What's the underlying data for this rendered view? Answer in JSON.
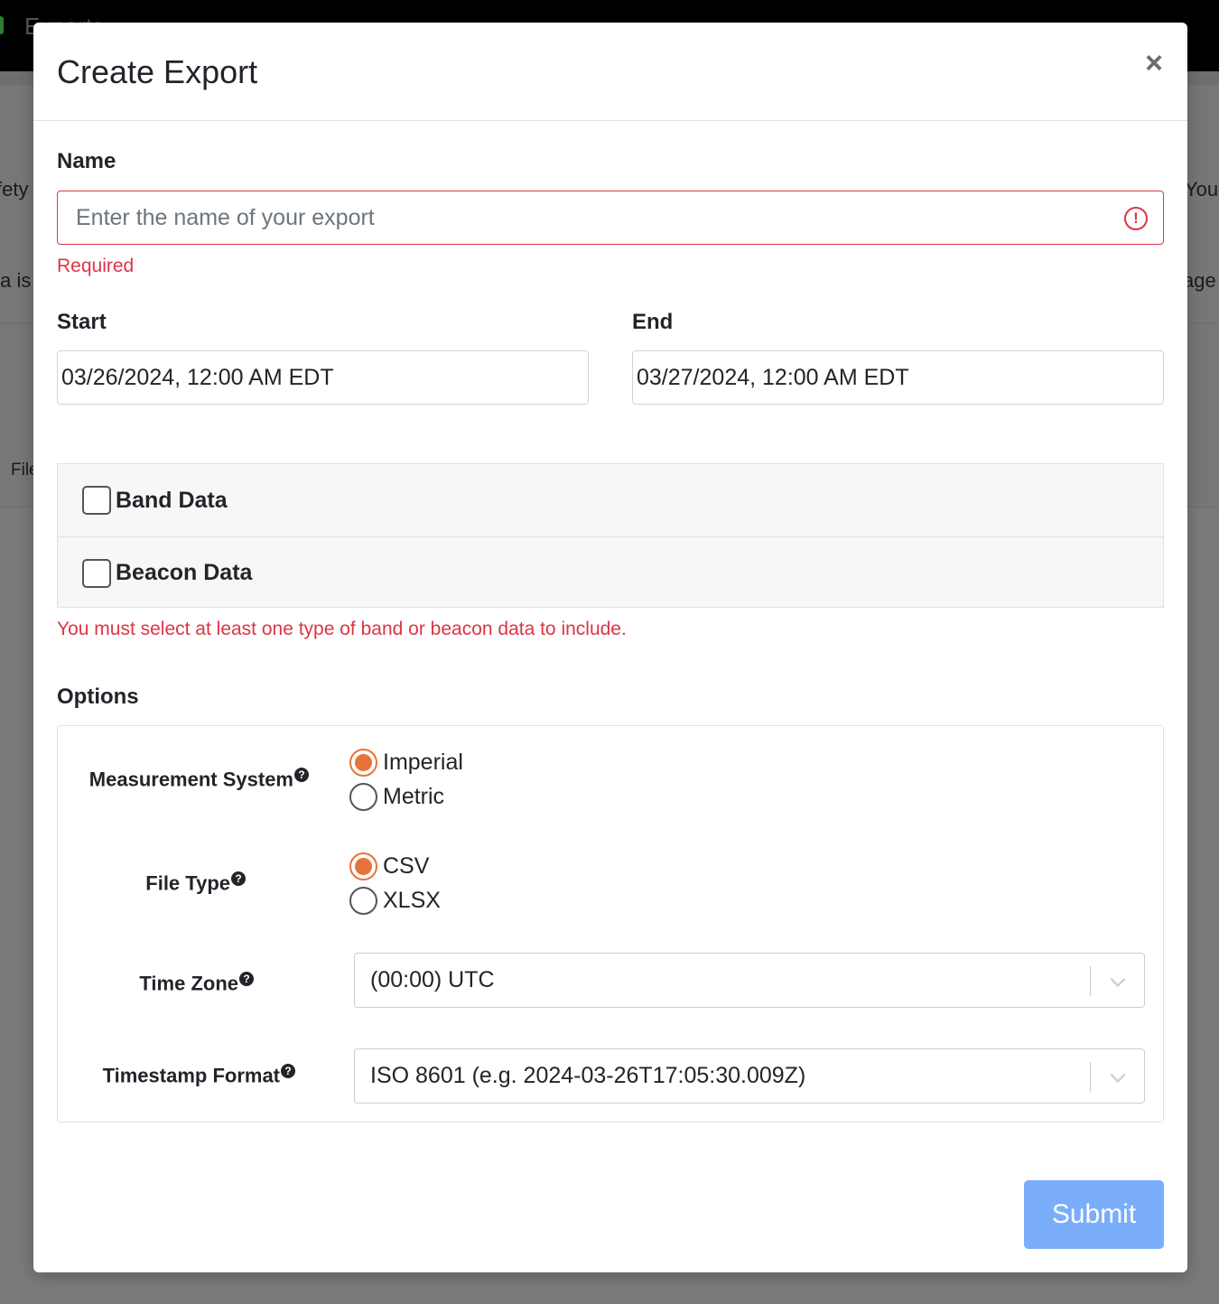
{
  "background": {
    "app_title": "Exports",
    "fragments": {
      "left_row1": "fety",
      "left_row2": "ta is",
      "left_row3": "File",
      "right_row1": "Your",
      "right_row2": "age"
    }
  },
  "modal": {
    "title": "Create Export",
    "close_label": "×",
    "name": {
      "label": "Name",
      "placeholder": "Enter the name of your export",
      "value": "",
      "error": "Required"
    },
    "start": {
      "label": "Start",
      "value": "03/26/2024, 12:00 AM EDT"
    },
    "end": {
      "label": "End",
      "value": "03/27/2024, 12:00 AM EDT"
    },
    "data_types": [
      {
        "label": "Band Data",
        "checked": false
      },
      {
        "label": "Beacon Data",
        "checked": false
      }
    ],
    "data_error": "You must select at least one type of band or beacon data to include.",
    "options": {
      "heading": "Options",
      "help_glyph": "?",
      "measurement_system": {
        "label": "Measurement System",
        "choices": [
          "Imperial",
          "Metric"
        ],
        "selected": "Imperial"
      },
      "file_type": {
        "label": "File Type",
        "choices": [
          "CSV",
          "XLSX"
        ],
        "selected": "CSV"
      },
      "time_zone": {
        "label": "Time Zone",
        "value": "(00:00) UTC"
      },
      "timestamp_format": {
        "label": "Timestamp Format",
        "value": "ISO 8601 (e.g. 2024-03-26T17:05:30.009Z)"
      }
    },
    "submit_label": "Submit"
  },
  "colors": {
    "accent": "#e8733a",
    "error": "#dc3545",
    "submit": "#7aadfa"
  }
}
